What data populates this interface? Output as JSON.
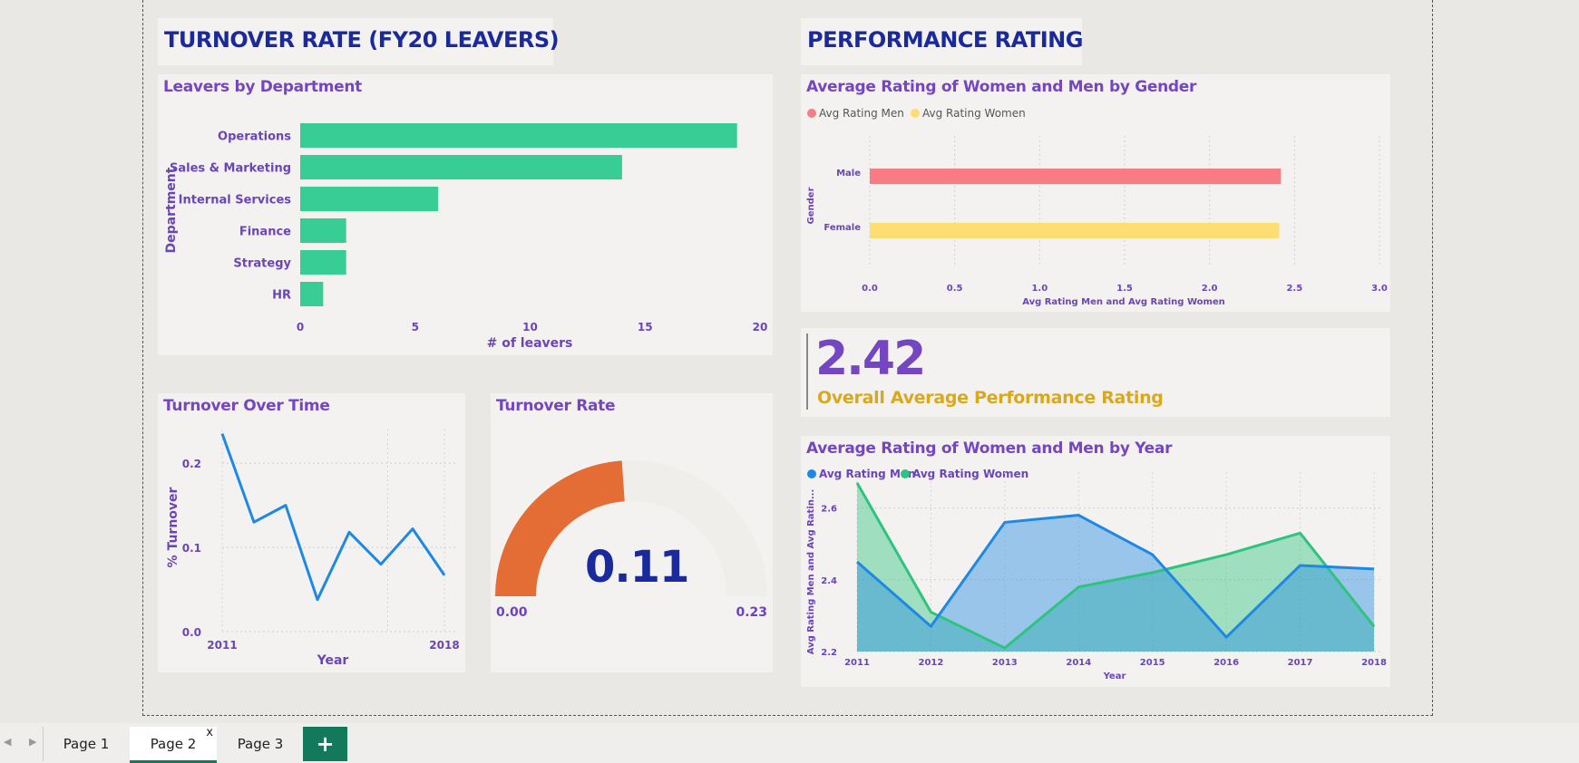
{
  "header_left": {
    "title": "TURNOVER RATE (FY20 LEAVERS)"
  },
  "header_right": {
    "title": "PERFORMANCE RATING"
  },
  "leavers_by_dept": {
    "title": "Leavers by Department",
    "chart_data": {
      "type": "bar",
      "orientation": "horizontal",
      "categories": [
        "Operations",
        "Sales & Marketing",
        "Internal Services",
        "Finance",
        "Strategy",
        "HR"
      ],
      "values": [
        19,
        14,
        6,
        2,
        2,
        1
      ],
      "xlabel": "# of leavers",
      "ylabel": "Department",
      "xlim": [
        0,
        20
      ],
      "xticks": [
        "0",
        "5",
        "10",
        "15",
        "20"
      ],
      "color": "#37cd95"
    }
  },
  "turnover_over_time": {
    "title": "Turnover Over Time",
    "chart_data": {
      "type": "line",
      "x": [
        2011,
        2012,
        2013,
        2014,
        2015,
        2016,
        2017,
        2018
      ],
      "y": [
        0.235,
        0.13,
        0.15,
        0.038,
        0.118,
        0.08,
        0.122,
        0.067
      ],
      "xlabel": "Year",
      "ylabel": "% Turnover",
      "ylim": [
        0,
        0.24
      ],
      "yticks": [
        "0.0",
        "0.1",
        "0.2"
      ],
      "xticks": [
        "2011",
        "2018"
      ],
      "color": "#1e88e5"
    }
  },
  "turnover_rate": {
    "title": "Turnover Rate",
    "value": "0.11",
    "min": "0.00",
    "max": "0.23",
    "fraction": 0.478,
    "color": "#e46c35"
  },
  "avg_rating_gender": {
    "title": "Average Rating of Women and Men by Gender",
    "legend": [
      {
        "label": "Avg Rating Men",
        "color": "#f97c84"
      },
      {
        "label": "Avg Rating Women",
        "color": "#fedd73"
      }
    ],
    "chart_data": {
      "type": "bar",
      "orientation": "horizontal",
      "categories": [
        "Male",
        "Female"
      ],
      "series": [
        {
          "name": "Avg Rating Men",
          "values": [
            2.42,
            null
          ]
        },
        {
          "name": "Avg Rating Women",
          "values": [
            null,
            2.41
          ]
        }
      ],
      "xlabel": "Avg Rating Men and Avg Rating Women",
      "ylabel": "Gender",
      "xlim": [
        0,
        3
      ],
      "xticks": [
        "0.0",
        "0.5",
        "1.0",
        "1.5",
        "2.0",
        "2.5",
        "3.0"
      ]
    }
  },
  "kpi": {
    "value": "2.42",
    "label": "Overall Average Performance Rating"
  },
  "avg_rating_year": {
    "title": "Average Rating of Women and Men by Year",
    "legend": [
      {
        "label": "Avg Rating Men",
        "color": "#1e88e5"
      },
      {
        "label": "Avg Rating Women",
        "color": "#2ec47f"
      }
    ],
    "chart_data": {
      "type": "area",
      "categories": [
        "2011",
        "2012",
        "2013",
        "2014",
        "2015",
        "2016",
        "2017",
        "2018"
      ],
      "series": [
        {
          "name": "Avg Rating Men",
          "values": [
            2.45,
            2.27,
            2.56,
            2.58,
            2.47,
            2.24,
            2.44,
            2.43
          ]
        },
        {
          "name": "Avg Rating Women",
          "values": [
            2.67,
            2.31,
            2.21,
            2.38,
            2.42,
            2.47,
            2.53,
            2.27
          ]
        }
      ],
      "xlabel": "Year",
      "ylabel": "Avg Rating Men and Avg Ratin...",
      "ylim": [
        2.2,
        2.7
      ],
      "yticks": [
        "2.2",
        "2.4",
        "2.6"
      ]
    }
  },
  "tabs": {
    "page1": "Page 1",
    "page2": "Page 2",
    "page3": "Page 3",
    "close": "x",
    "add": "+"
  }
}
